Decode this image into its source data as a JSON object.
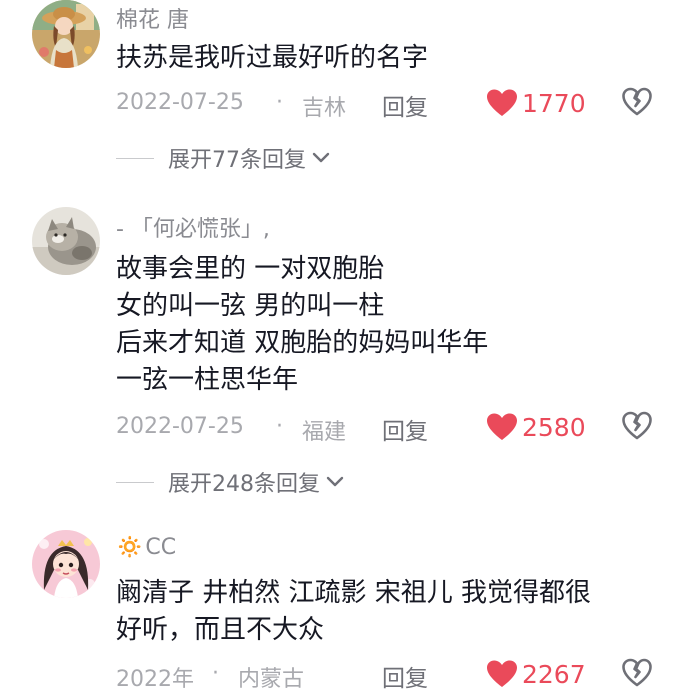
{
  "comments": [
    {
      "username": "棉花 唐",
      "content": "扶苏是我听过最好听的名字",
      "date": "2022-07-25",
      "separator": "·",
      "location": "吉林",
      "reply_label": "回复",
      "likes": "1770",
      "expand_label": "展开77条回复"
    },
    {
      "username": "- 「何必慌张」,",
      "content": "故事会里的 一对双胞胎\n女的叫一弦 男的叫一柱\n后来才知道 双胞胎的妈妈叫华年\n一弦一柱思华年",
      "date": "2022-07-25",
      "separator": "·",
      "location": "福建",
      "reply_label": "回复",
      "likes": "2580",
      "expand_label": "展开248条回复"
    },
    {
      "username_prefix": "🔅",
      "username": "CC",
      "content": "阚清子  井柏然  江疏影  宋祖儿 我觉得都很\n好听，而且不大众",
      "date": "2022年",
      "separator": "·",
      "location": "内蒙古",
      "reply_label": "回复",
      "likes": "2267"
    }
  ],
  "icons": {
    "like": "heart-icon",
    "dislike": "broken-heart-icon",
    "expand": "chevron-down-icon"
  },
  "colors": {
    "like_red": "#ea4a5a",
    "meta_gray": "#a8a9ae",
    "text_dark": "#161823",
    "username_gray": "#8a8b91"
  }
}
